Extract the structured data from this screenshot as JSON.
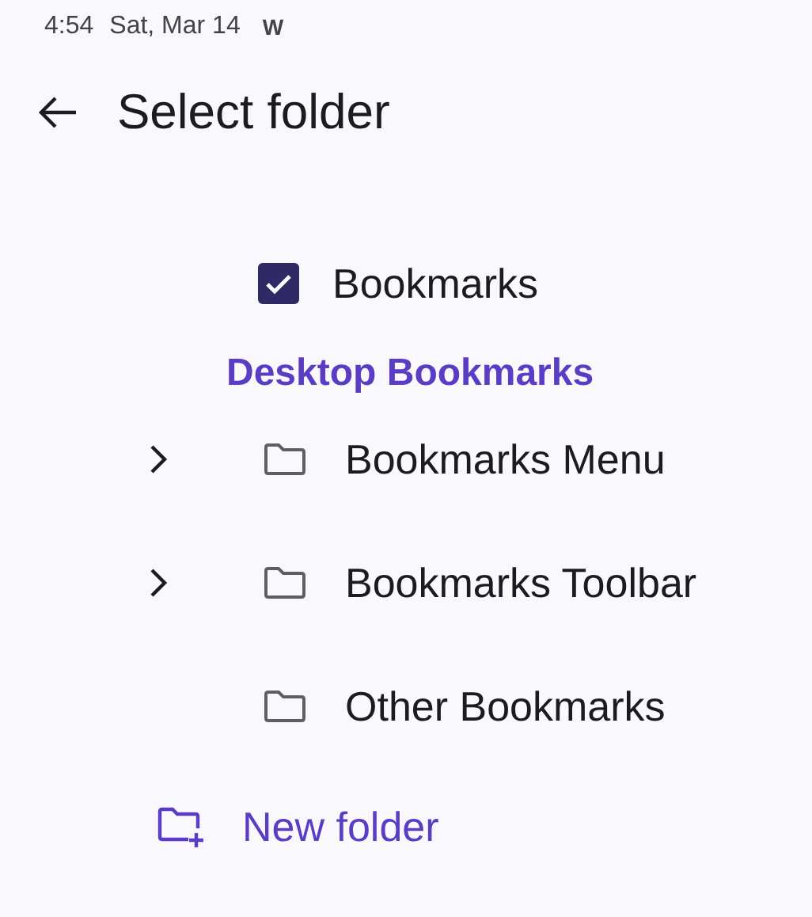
{
  "status_bar": {
    "time": "4:54",
    "date": "Sat, Mar 14",
    "app_mark": "W"
  },
  "header": {
    "title": "Select folder"
  },
  "root": {
    "label": "Bookmarks",
    "checked": true
  },
  "section": {
    "title": "Desktop Bookmarks"
  },
  "folders": [
    {
      "label": "Bookmarks Menu",
      "expandable": true
    },
    {
      "label": "Bookmarks Toolbar",
      "expandable": true
    },
    {
      "label": "Other Bookmarks",
      "expandable": false
    }
  ],
  "new_folder": {
    "label": "New folder"
  }
}
